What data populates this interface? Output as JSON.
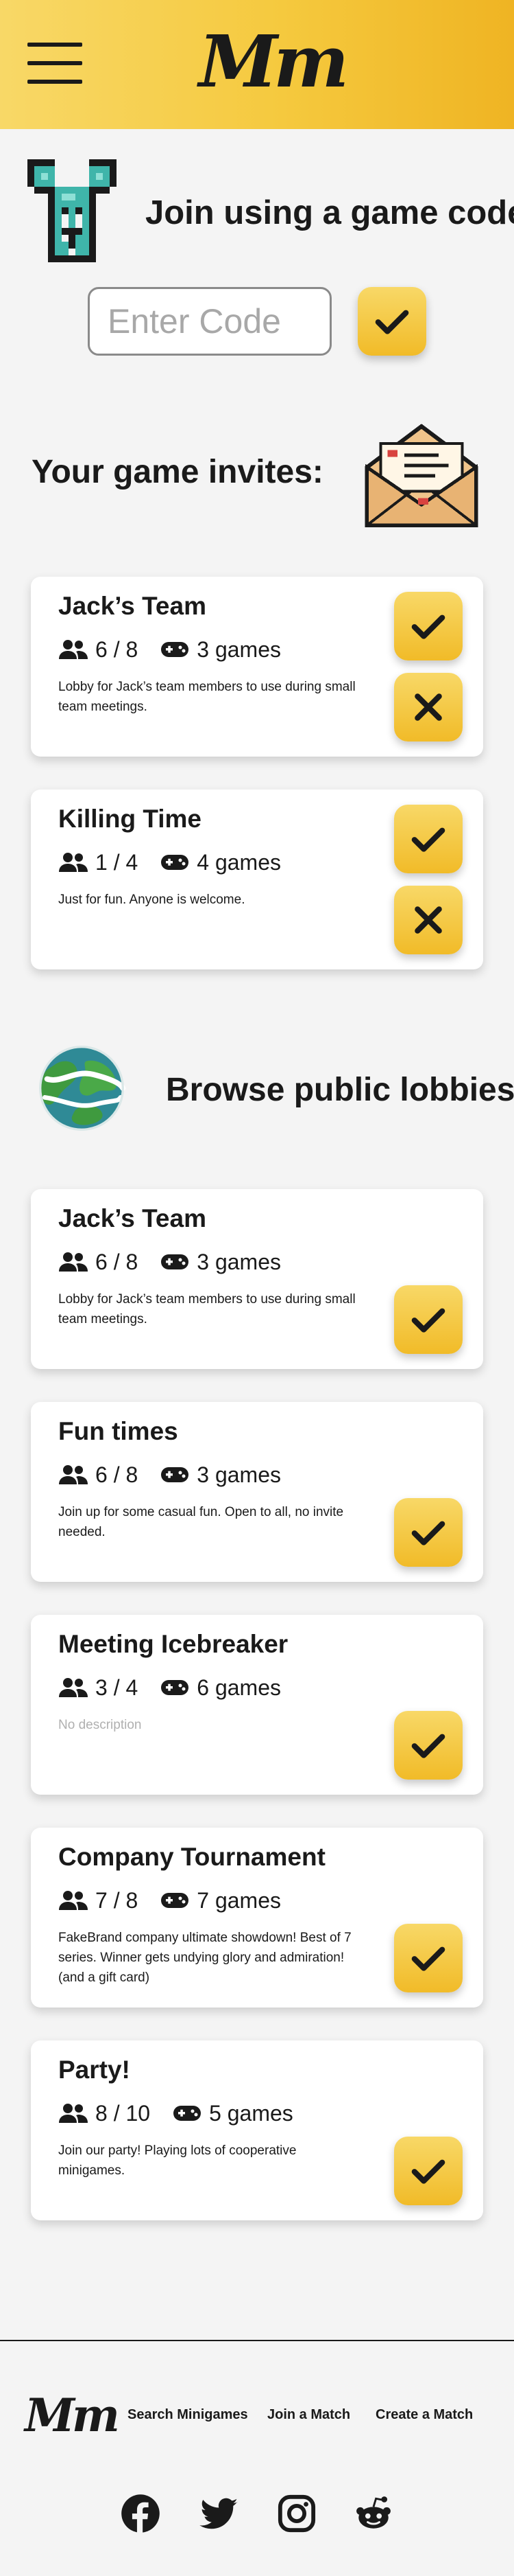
{
  "header": {
    "logo_text": "Mm",
    "menu_icon": "hamburger-icon",
    "colors": {
      "gradient_start": "#f8d867",
      "gradient_end": "#efb423"
    }
  },
  "join": {
    "title": "Join using a game code:",
    "input_placeholder": "Enter Code",
    "input_value": "",
    "submit_icon": "check-icon"
  },
  "invites": {
    "title": "Your game invites:",
    "items": [
      {
        "name": "Jack’s Team",
        "players": "6 / 8",
        "games": "3 games",
        "description": "Lobby for Jack’s team members to use during small team meetings."
      },
      {
        "name": "Killing Time",
        "players": "1 / 4",
        "games": "4 games",
        "description": "Just for fun.  Anyone is welcome."
      }
    ]
  },
  "browse": {
    "title": "Browse public lobbies:",
    "items": [
      {
        "name": "Jack’s Team",
        "players": "6 / 8",
        "games": "3 games",
        "description": "Lobby for Jack’s team members to use during small team meetings."
      },
      {
        "name": "Fun times",
        "players": "6 / 8",
        "games": "3 games",
        "description": "Join up for some casual fun.  Open to all, no invite needed."
      },
      {
        "name": "Meeting Icebreaker",
        "players": "3 / 4",
        "games": "6 games",
        "description": "No description"
      },
      {
        "name": "Company Tournament",
        "players": "7 / 8",
        "games": "7 games",
        "description": "FakeBrand company ultimate showdown!  Best of 7 series.  Winner gets undying glory and admiration! (and a gift card)"
      },
      {
        "name": "Party!",
        "players": "8 / 10",
        "games": "5 games",
        "description": "Join our party!  Playing lots of cooperative minigames."
      }
    ]
  },
  "footer": {
    "logo_text": "Mm",
    "links": [
      "Search Minigames",
      "Join a Match",
      "Create a Match"
    ],
    "social": [
      "facebook-icon",
      "twitter-icon",
      "instagram-icon",
      "reddit-icon"
    ]
  },
  "colors": {
    "accent": "#f5c93e",
    "button_top": "#f8d867",
    "button_bottom": "#f1bb28",
    "text": "#1a1a1a",
    "background": "#f4f4f4"
  }
}
